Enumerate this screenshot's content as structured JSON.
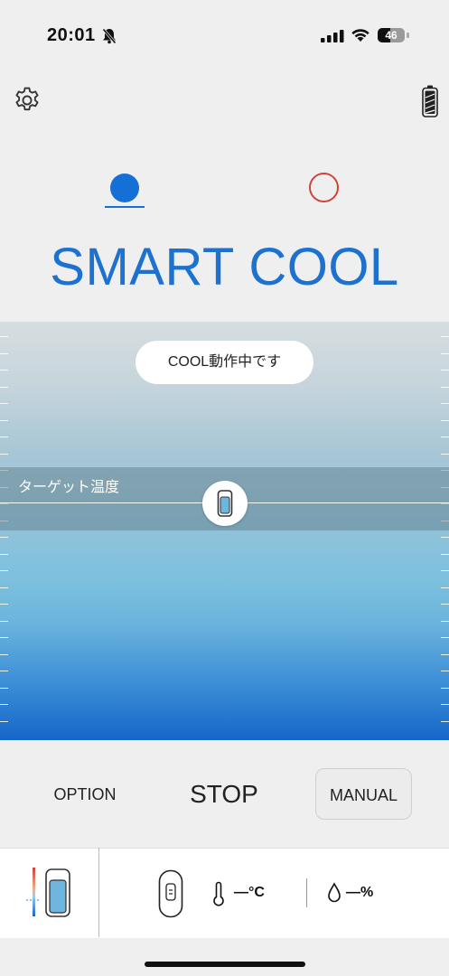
{
  "status_bar": {
    "time": "20:01",
    "battery_level": 46,
    "battery_text": "46"
  },
  "colors": {
    "accent": "#1e72cf",
    "warm": "#d0433a"
  },
  "mode": {
    "title": "SMART COOL"
  },
  "panel": {
    "status": "COOL動作中です",
    "target_label": "ターゲット温度"
  },
  "controls": {
    "option": "OPTION",
    "stop": "STOP",
    "manual": "MANUAL"
  },
  "readings": {
    "temperature": "—°C",
    "humidity": "—%"
  }
}
